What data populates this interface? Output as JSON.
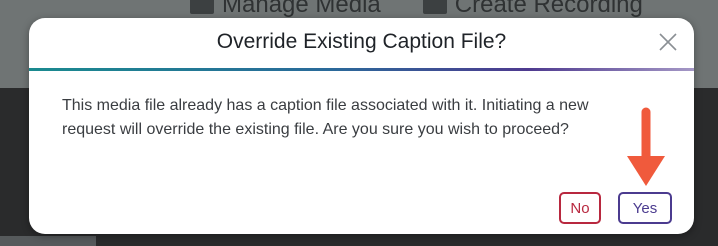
{
  "background": {
    "toolbar": [
      {
        "label": "Manage Media",
        "icon": "media-icon"
      },
      {
        "label": "Create Recording",
        "icon": "record-icon"
      }
    ]
  },
  "dialog": {
    "title": "Override Existing Caption File?",
    "close_icon": "close-icon",
    "message": "This media file already has a caption file associated with it. Initiating a new request will override the existing file. Are you sure you wish to proceed?",
    "no_label": "No",
    "yes_label": "Yes"
  },
  "annotation": {
    "arrow_color": "#f05a3c",
    "target": "yes-button"
  },
  "colors": {
    "no_button": "#b8283f",
    "yes_button": "#4b3b8f",
    "overlay_top": "#6f7474",
    "overlay_bottom": "#2a2b2c"
  }
}
